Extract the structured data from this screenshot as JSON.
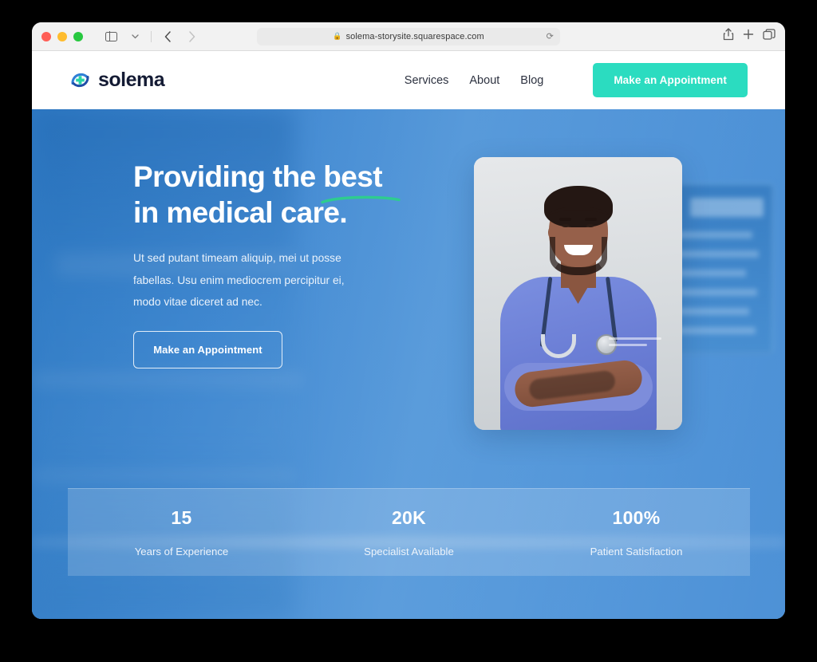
{
  "browser": {
    "url": "solema-storysite.squarespace.com",
    "lock_icon": "lock-icon",
    "reload_icon": "reload-icon",
    "sidebar_icon": "sidebar-toggle-icon",
    "chevron_icon": "chevron-down-icon",
    "back_icon": "back-arrow-icon",
    "forward_icon": "forward-arrow-icon",
    "share_icon": "share-icon",
    "newtab_icon": "plus-icon",
    "tabs_icon": "tab-overview-icon"
  },
  "site": {
    "brand": "solema",
    "logo_icon": "medical-cross-circle-logo",
    "nav": [
      {
        "label": "Services"
      },
      {
        "label": "About"
      },
      {
        "label": "Blog"
      }
    ],
    "nav_cta": "Make an Appointment"
  },
  "hero": {
    "headline_line1_a": "Providing the ",
    "headline_highlight": "best",
    "headline_line2": "in medical care.",
    "paragraph": "Ut sed putant timeam aliquip, mei ut posse fabellas. Usu enim mediocrem percipitur ei, modo vitae diceret ad nec.",
    "cta": "Make an Appointment",
    "portrait_alt": "smiling-doctor-in-blue-scrubs-with-stethoscope",
    "background_alt": "blurred-hospital-corridor"
  },
  "stats": [
    {
      "value": "15",
      "label": "Years of Experience"
    },
    {
      "value": "20K",
      "label": "Specialist Available"
    },
    {
      "value": "100%",
      "label": "Patient Satisfiaction"
    }
  ],
  "colors": {
    "accent_teal": "#2bdcc0",
    "underline_green": "#2ecc8f",
    "hero_blue": "#4a90d9",
    "brand_navy": "#141b34"
  }
}
